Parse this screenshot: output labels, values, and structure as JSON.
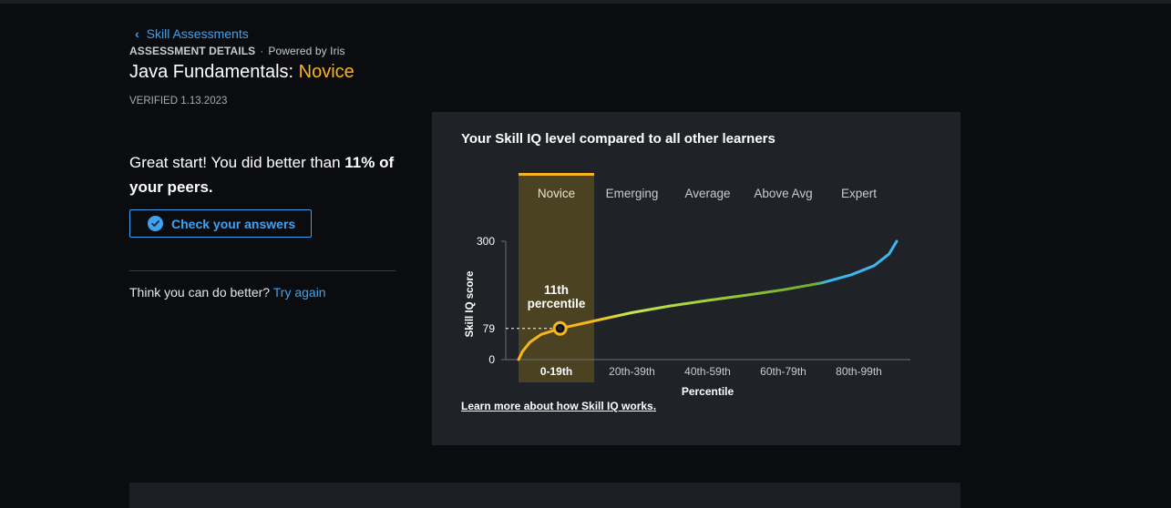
{
  "nav": {
    "back_label": "Skill Assessments"
  },
  "header": {
    "details_label": "ASSESSMENT DETAILS",
    "separator": "·",
    "powered_by": "Powered by Iris",
    "title_prefix": "Java Fundamentals:",
    "level": "Novice",
    "verified": "VERIFIED 1.13.2023"
  },
  "result": {
    "text_before": "Great start! You did better than ",
    "percent": "11%",
    "text_after": " of your peers.",
    "check_button_label": "Check your answers",
    "retry_prompt": "Think you can do better?",
    "retry_link": "Try again"
  },
  "card": {
    "title": "Your Skill IQ level compared to all other learners",
    "learn_more": "Learn more about how Skill IQ works."
  },
  "colors": {
    "accent_blue": "#3fa2f0",
    "novice_yellow": "#f9b51b",
    "curve_green": "#8fc23a",
    "curve_lime": "#c5e84a",
    "expert_blue": "#3bb8ef"
  },
  "chart_data": {
    "type": "line",
    "ylabel": "Skill IQ score",
    "xlabel": "Percentile",
    "yticks": [
      "300",
      "79",
      "0"
    ],
    "ylim": [
      0,
      300
    ],
    "levels": [
      "Novice",
      "Emerging",
      "Average",
      "Above Avg",
      "Expert"
    ],
    "categories": [
      "0-19th",
      "20th-39th",
      "40th-59th",
      "60th-79th",
      "80th-99th"
    ],
    "highlighted_level_index": 0,
    "marker": {
      "percentile": 11,
      "score": 79,
      "label_line1": "11th",
      "label_line2": "percentile"
    },
    "x": [
      0,
      1,
      3,
      6,
      11,
      20,
      30,
      40,
      50,
      60,
      70,
      80,
      88,
      94,
      98,
      100
    ],
    "y": [
      0,
      20,
      44,
      64,
      79,
      98,
      119,
      136,
      150,
      163,
      177,
      194,
      215,
      238,
      268,
      300
    ]
  }
}
